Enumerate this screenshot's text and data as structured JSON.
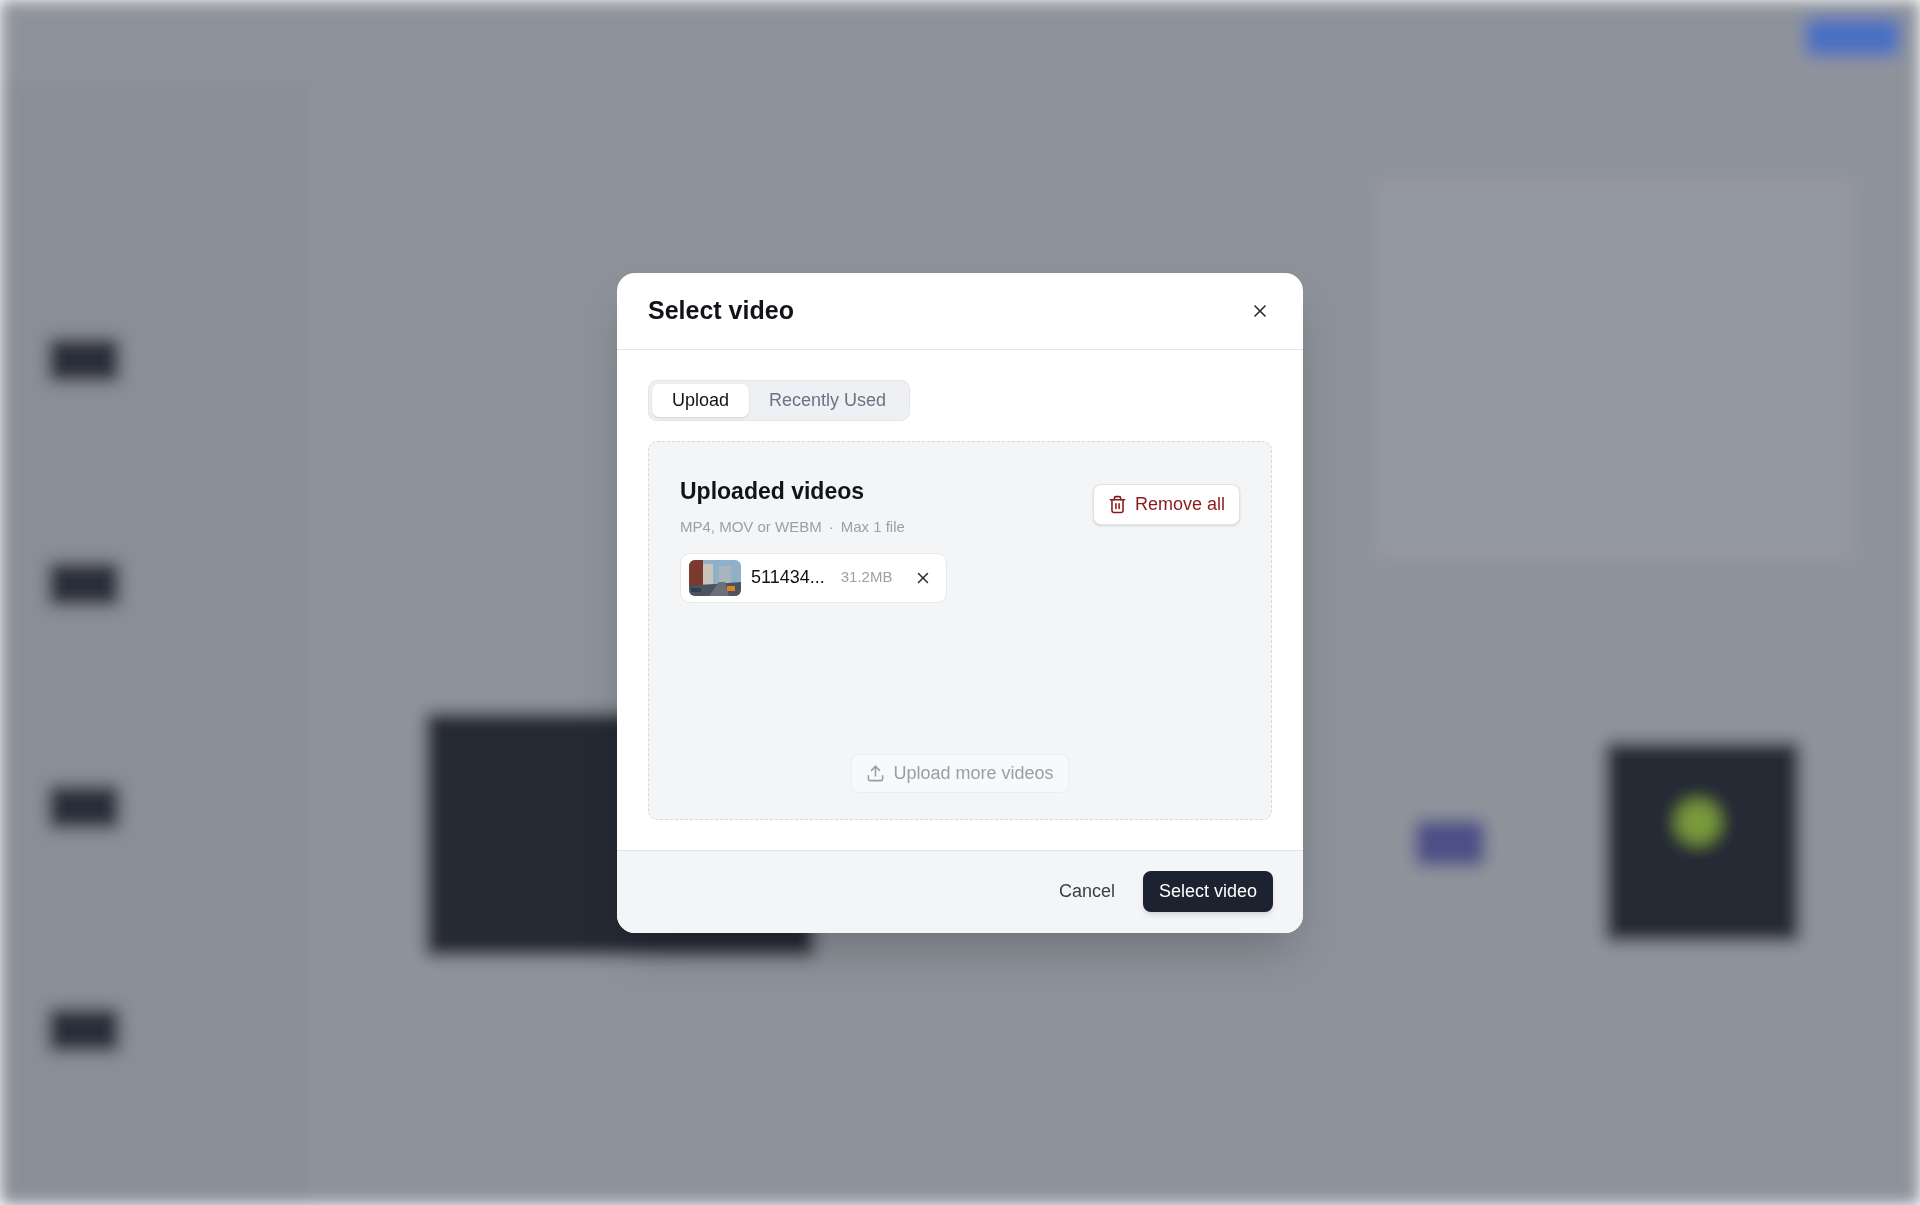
{
  "dialog": {
    "title": "Select video",
    "tabs": [
      {
        "label": "Upload",
        "selected": true
      },
      {
        "label": "Recently Used",
        "selected": false
      }
    ],
    "uploads": {
      "heading": "Uploaded videos",
      "formats": "MP4, MOV or WEBM",
      "separator": "·",
      "limit": "Max 1 file",
      "remove_all": "Remove all",
      "files": [
        {
          "name": "511434...",
          "size": "31.2MB"
        }
      ],
      "upload_more": {
        "label": "Upload more videos",
        "disabled": true
      }
    },
    "buttons": [
      {
        "label": "Cancel",
        "kind": "secondary"
      },
      {
        "label": "Select video",
        "kind": "primary"
      }
    ]
  }
}
